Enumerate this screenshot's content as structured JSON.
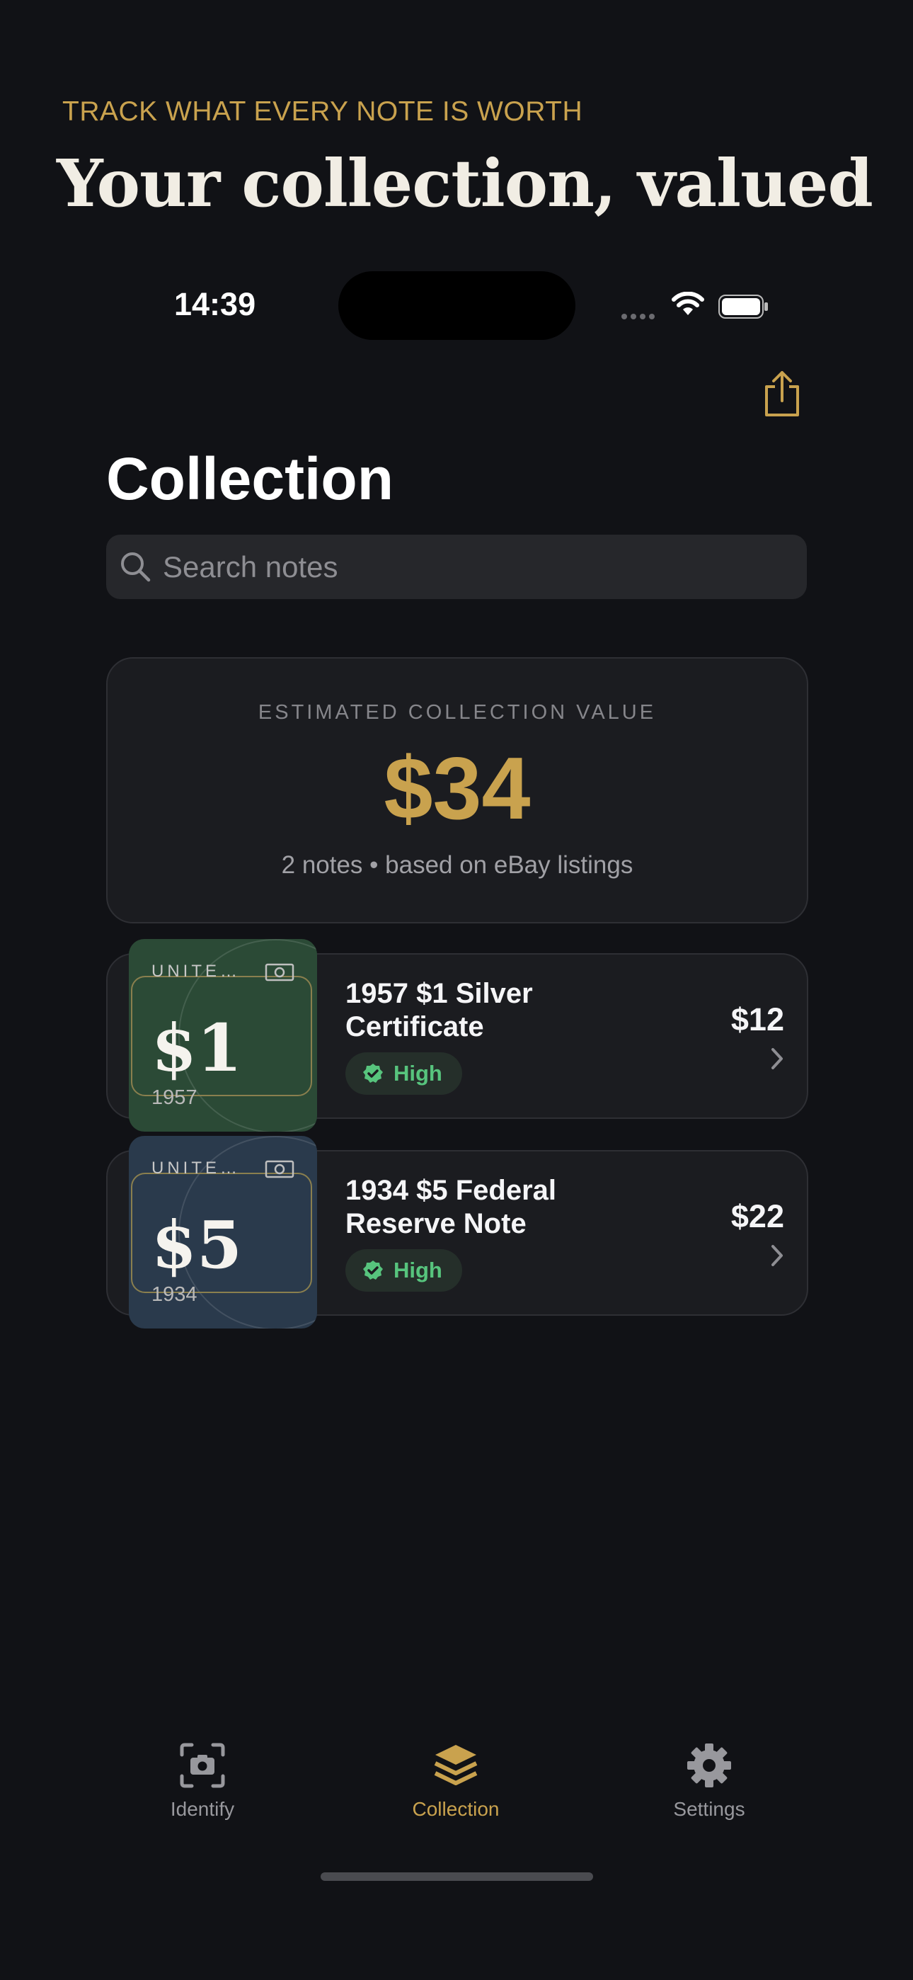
{
  "promo": {
    "tagline": "TRACK WHAT EVERY NOTE IS WORTH",
    "headline": "Your collection, valued"
  },
  "status_bar": {
    "time": "14:39"
  },
  "header": {
    "title": "Collection",
    "share_icon": "share-icon"
  },
  "search": {
    "placeholder": "Search notes"
  },
  "summary": {
    "label": "ESTIMATED COLLECTION VALUE",
    "amount": "$34",
    "subtitle": "2 notes • based on eBay listings"
  },
  "notes": [
    {
      "issuer": "UNITE…",
      "denomination": "$1",
      "year": "1957",
      "title": "1957 $1 Silver Certificate",
      "confidence": "High",
      "price": "$12",
      "color": "#2b4a36"
    },
    {
      "issuer": "UNITE…",
      "denomination": "$5",
      "year": "1934",
      "title": "1934 $5 Federal Reserve Note",
      "confidence": "High",
      "price": "$22",
      "color": "#2a3a4c"
    }
  ],
  "tabs": [
    {
      "label": "Identify",
      "icon": "camera-icon",
      "active": false
    },
    {
      "label": "Collection",
      "icon": "stack-icon",
      "active": true
    },
    {
      "label": "Settings",
      "icon": "gear-icon",
      "active": false
    }
  ],
  "colors": {
    "accent": "#c9a24e",
    "background": "#111216",
    "confidence_high": "#57c47d"
  }
}
